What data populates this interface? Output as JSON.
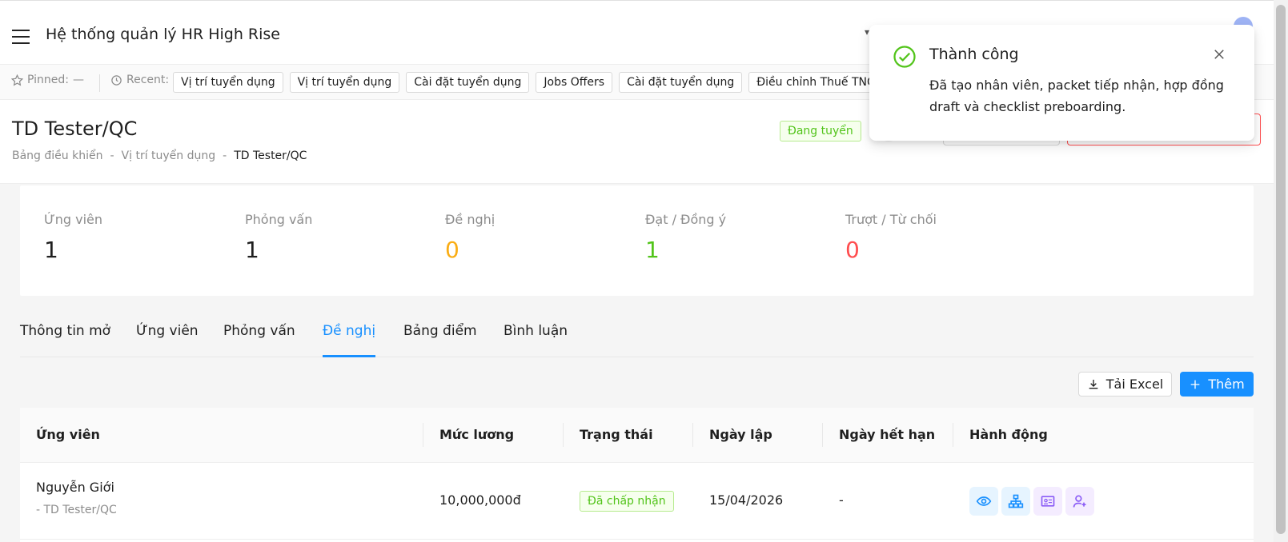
{
  "app": {
    "title": "Hệ thống quản lý HR High Rise"
  },
  "pinned": {
    "label": "Pinned:",
    "value": "—"
  },
  "recent": {
    "label": "Recent:",
    "items": [
      "Vị trí tuyển dụng",
      "Vị trí tuyển dụng",
      "Cài đặt tuyển dụng",
      "Jobs Offers",
      "Cài đặt tuyển dụng",
      "Điều chỉnh Thuế TNCN"
    ]
  },
  "page": {
    "title": "TD Tester/QC",
    "status": "Đang tuyển",
    "breadcrumb": [
      "Bảng điều khiển",
      "Vị trí tuyển dụng",
      "TD Tester/QC"
    ],
    "breadcrumb_sep": "-"
  },
  "stats": [
    {
      "label": "Ứng viên",
      "value": "1",
      "color": "#1f1f1f"
    },
    {
      "label": "Phỏng vấn",
      "value": "1",
      "color": "#1f1f1f"
    },
    {
      "label": "Đề nghị",
      "value": "0",
      "color": "#faad14"
    },
    {
      "label": "Đạt / Đồng ý",
      "value": "1",
      "color": "#52c41a"
    },
    {
      "label": "Trượt / Từ chối",
      "value": "0",
      "color": "#ff4d4f"
    }
  ],
  "tabs": [
    {
      "label": "Thông tin mở",
      "active": false
    },
    {
      "label": "Ứng viên",
      "active": false
    },
    {
      "label": "Phỏng vấn",
      "active": false
    },
    {
      "label": "Đề nghị",
      "active": true
    },
    {
      "label": "Bảng điểm",
      "active": false
    },
    {
      "label": "Bình luận",
      "active": false
    }
  ],
  "toolbar": {
    "excel_label": "Tải Excel",
    "add_label": "Thêm"
  },
  "table": {
    "columns": [
      "Ứng viên",
      "Mức lương",
      "Trạng thái",
      "Ngày lập",
      "Ngày hết hạn",
      "Hành động"
    ],
    "rows": [
      {
        "name": "Nguyễn Giới",
        "position": "- TD Tester/QC",
        "salary": "10,000,000đ",
        "status": "Đã chấp nhận",
        "created": "15/04/2026",
        "expires": "-",
        "actions": [
          "view-icon",
          "org-chart-icon",
          "id-card-icon",
          "add-user-icon"
        ]
      }
    ]
  },
  "toast": {
    "title": "Thành công",
    "message": "Đã tạo nhân viên, packet tiếp nhận, hợp đồng draft và checklist preboarding."
  },
  "colors": {
    "primary": "#1890ff",
    "success": "#52c41a",
    "warning": "#faad14",
    "danger": "#ff4d4f"
  }
}
